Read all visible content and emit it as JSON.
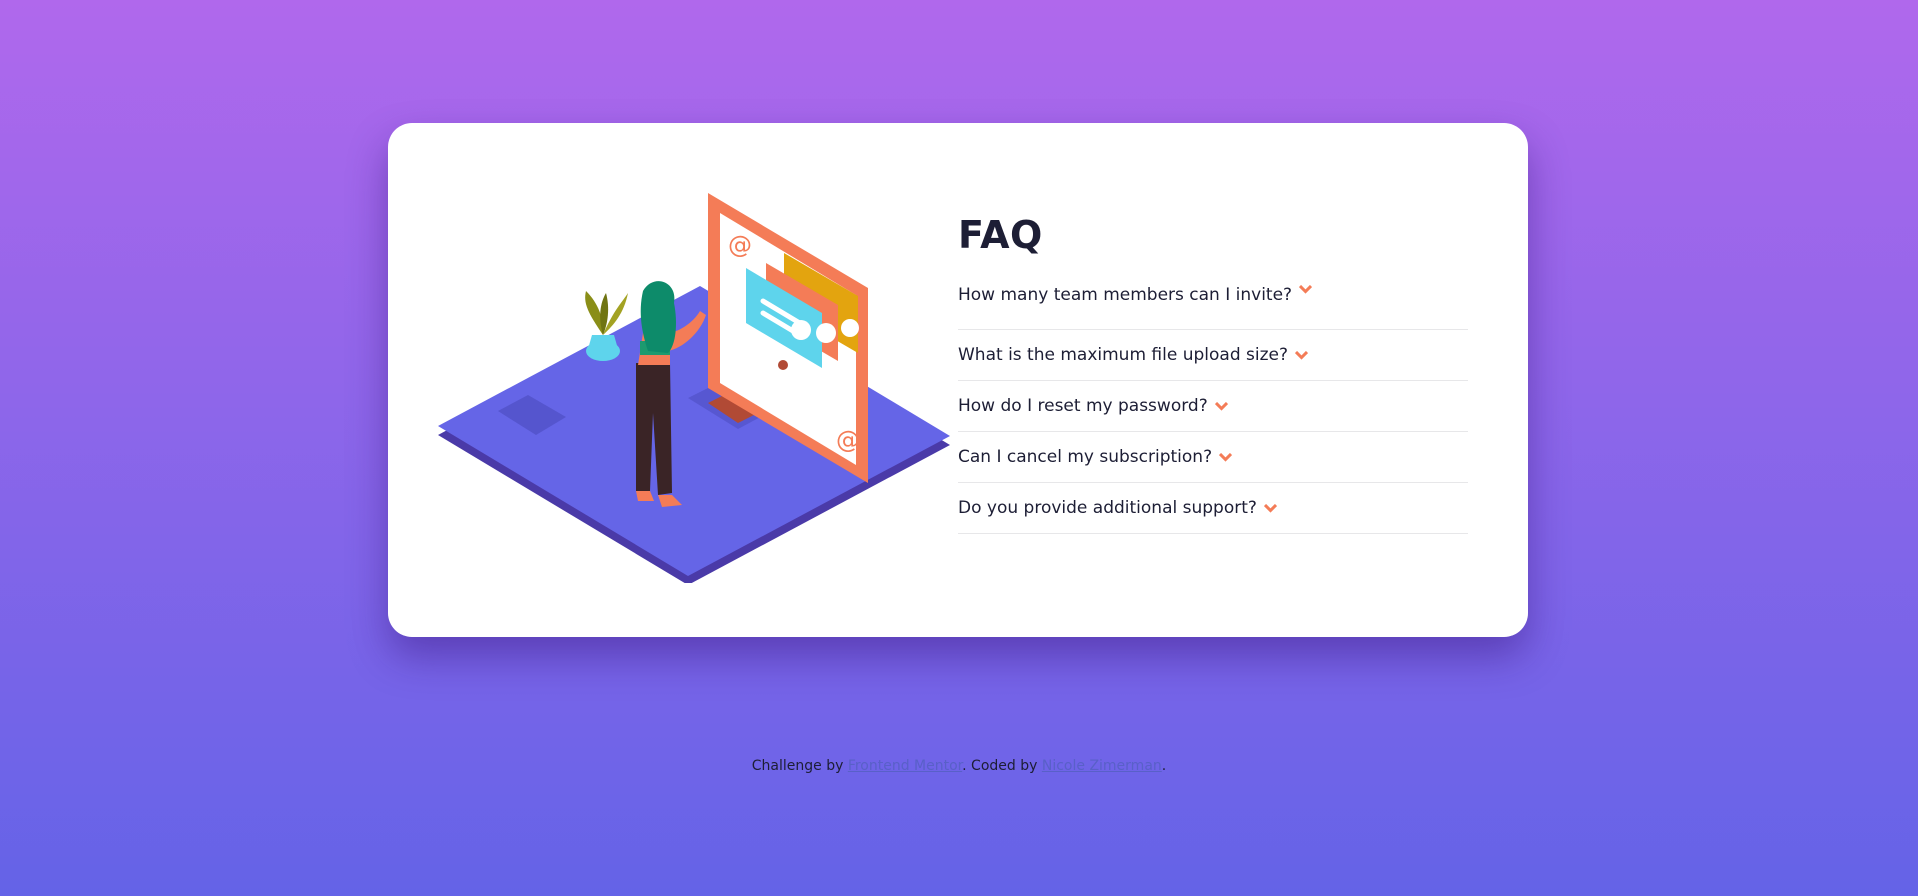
{
  "faq": {
    "title": "FAQ",
    "questions": [
      {
        "label": "How many team members can I invite?"
      },
      {
        "label": "What is the maximum file upload size?"
      },
      {
        "label": "How do I reset my password?"
      },
      {
        "label": "Can I cancel my subscription?"
      },
      {
        "label": "Do you provide additional support?"
      }
    ],
    "chevron_icon": "chevron-down-icon",
    "accent_color": "#f47c57"
  },
  "footer": {
    "prefix": "Challenge by",
    "link1": "Frontend Mentor",
    "middle": ". Coded by",
    "link2": "Nicole Zimerman",
    "suffix": "."
  },
  "colors": {
    "background_top": "#b068ec",
    "background_bottom": "#6463e7",
    "card": "#ffffff",
    "text": "#1d1e35",
    "link": "#5960c8"
  }
}
